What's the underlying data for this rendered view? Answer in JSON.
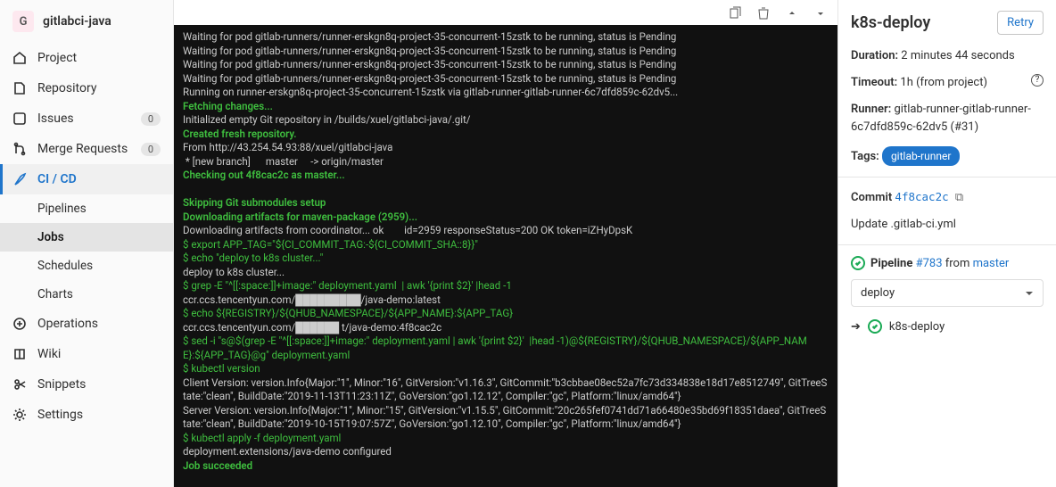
{
  "project": {
    "initial": "G",
    "name": "gitlabci-java"
  },
  "nav": {
    "project": "Project",
    "repository": "Repository",
    "issues": "Issues",
    "issues_count": "0",
    "mrs": "Merge Requests",
    "mrs_count": "0",
    "cicd": "CI / CD",
    "sub": {
      "pipelines": "Pipelines",
      "jobs": "Jobs",
      "schedules": "Schedules",
      "charts": "Charts"
    },
    "operations": "Operations",
    "wiki": "Wiki",
    "snippets": "Snippets",
    "settings": "Settings"
  },
  "log": {
    "l1": "Waiting for pod gitlab-runners/runner-erskgn8q-project-35-concurrent-15zstk to be running, status is Pending",
    "l2": "Waiting for pod gitlab-runners/runner-erskgn8q-project-35-concurrent-15zstk to be running, status is Pending",
    "l3": "Waiting for pod gitlab-runners/runner-erskgn8q-project-35-concurrent-15zstk to be running, status is Pending",
    "l4": "Waiting for pod gitlab-runners/runner-erskgn8q-project-35-concurrent-15zstk to be running, status is Pending",
    "l5": "Running on runner-erskgn8q-project-35-concurrent-15zstk via gitlab-runner-gitlab-runner-6c7dfd859c-62dv5...",
    "l6": "Fetching changes...",
    "l7": "Initialized empty Git repository in /builds/xuel/gitlabci-java/.git/",
    "l8": "Created fresh repository.",
    "l9": "From http://43.254.54.93:88/xuel/gitlabci-java",
    "l10": " * [new branch]      master     -> origin/master",
    "l11": "Checking out 4f8cac2c as master...",
    "l12": "Skipping Git submodules setup",
    "l13": "Downloading artifacts for maven-package (2959)...",
    "l14": "Downloading artifacts from coordinator... ok        id=2959 responseStatus=200 OK token=iZHyDpsK",
    "l15": "$ export APP_TAG=\"${CI_COMMIT_TAG:-${CI_COMMIT_SHA::8}}\"",
    "l16": "$ echo \"deploy to k8s cluster...\"",
    "l17": "deploy to k8s cluster...",
    "l18": "$ grep -E \"^[[:space:]]+image:\" deployment.yaml  | awk '{print $2}' |head -1",
    "l19": "ccr.ccs.tencentyun.com/█████████/java-demo:latest",
    "l20": "$ echo ${REGISTRY}/${QHUB_NAMESPACE}/${APP_NAME}:${APP_TAG}",
    "l21": "ccr.ccs.tencentyun.com/██████ t/java-demo:4f8cac2c",
    "l22": "$ sed -i \"s@$(grep -E \"^[[:space:]]+image:\" deployment.yaml | awk '{print $2}'  |head -1)@${REGISTRY}/${QHUB_NAMESPACE}/${APP_NAME}:${APP_TAG}@g\" deployment.yaml",
    "l23": "$ kubectl version",
    "l24": "Client Version: version.Info{Major:\"1\", Minor:\"16\", GitVersion:\"v1.16.3\", GitCommit:\"b3cbbae08ec52a7fc73d334838e18d17e8512749\", GitTreeState:\"clean\", BuildDate:\"2019-11-13T11:23:11Z\", GoVersion:\"go1.12.12\", Compiler:\"gc\", Platform:\"linux/amd64\"}",
    "l25": "Server Version: version.Info{Major:\"1\", Minor:\"15\", GitVersion:\"v1.15.5\", GitCommit:\"20c265fef0741dd71a66480e35bd69f18351daea\", GitTreeState:\"clean\", BuildDate:\"2019-10-15T19:07:57Z\", GoVersion:\"go1.12.10\", Compiler:\"gc\", Platform:\"linux/amd64\"}",
    "l26": "$ kubectl apply -f deployment.yaml",
    "l27": "deployment.extensions/java-demo configured",
    "l28": "Job succeeded"
  },
  "job": {
    "name": "k8s-deploy",
    "retry": "Retry",
    "duration_label": "Duration:",
    "duration_value": " 2 minutes 44 seconds",
    "timeout_label": "Timeout:",
    "timeout_value": " 1h (from project)",
    "runner_label": "Runner:",
    "runner_value": " gitlab-runner-gitlab-runner-6c7dfd859c-62dv5 (#31)",
    "tags_label": "Tags:",
    "tag": "gitlab-runner",
    "commit_label": "Commit",
    "commit_sha": "4f8cac2c",
    "commit_msg": "Update .gitlab-ci.yml",
    "pipeline_text": "Pipeline",
    "pipeline_id": "#783",
    "from": " from ",
    "branch": "master",
    "stage": "deploy",
    "job_row": "k8s-deploy"
  }
}
